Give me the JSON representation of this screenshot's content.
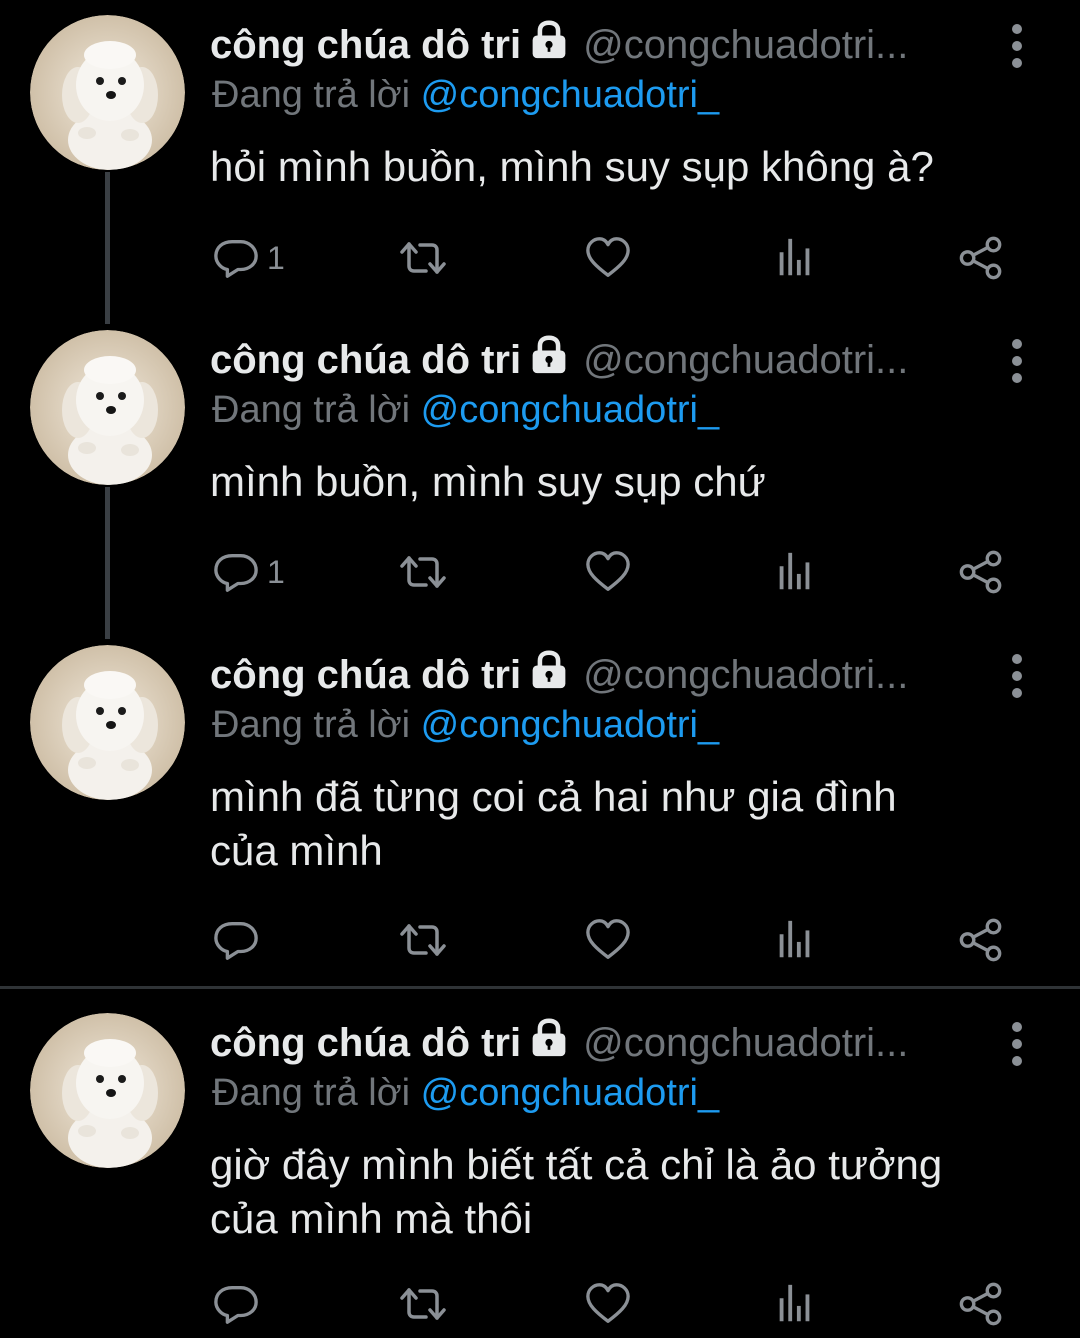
{
  "colors": {
    "background": "#000000",
    "text": "#e7e9ea",
    "muted": "#71767b",
    "link": "#1d9bf0",
    "icon": "#8b9096"
  },
  "tweets": [
    {
      "author": {
        "name": "công chúa dô tri",
        "handle": "@congchuadotri...",
        "locked": true
      },
      "reply_label": "Đang trả lời",
      "reply_mention": "@congchuadotri_",
      "lines": [
        "hỏi mình buồn, mình suy sụp không à?"
      ],
      "reply_count": "1"
    },
    {
      "author": {
        "name": "công chúa dô tri",
        "handle": "@congchuadotri...",
        "locked": true
      },
      "reply_label": "Đang trả lời",
      "reply_mention": "@congchuadotri_",
      "lines": [
        "mình buồn, mình suy sụp chứ"
      ],
      "reply_count": "1"
    },
    {
      "author": {
        "name": "công chúa dô tri",
        "handle": "@congchuadotri...",
        "locked": true
      },
      "reply_label": "Đang trả lời",
      "reply_mention": "@congchuadotri_",
      "lines": [
        "mình đã từng coi cả hai như gia đình",
        "của mình"
      ],
      "reply_count": ""
    },
    {
      "author": {
        "name": "công chúa dô tri",
        "handle": "@congchuadotri...",
        "locked": true
      },
      "reply_label": "Đang trả lời",
      "reply_mention": "@congchuadotri_",
      "lines": [
        "giờ đây mình biết tất cả chỉ là ảo tưởng",
        "của mình mà thôi"
      ],
      "reply_count": ""
    }
  ],
  "icons": [
    "reply-icon",
    "retweet-icon",
    "like-icon",
    "views-icon",
    "share-icon",
    "lock-icon",
    "more-options-icon"
  ]
}
